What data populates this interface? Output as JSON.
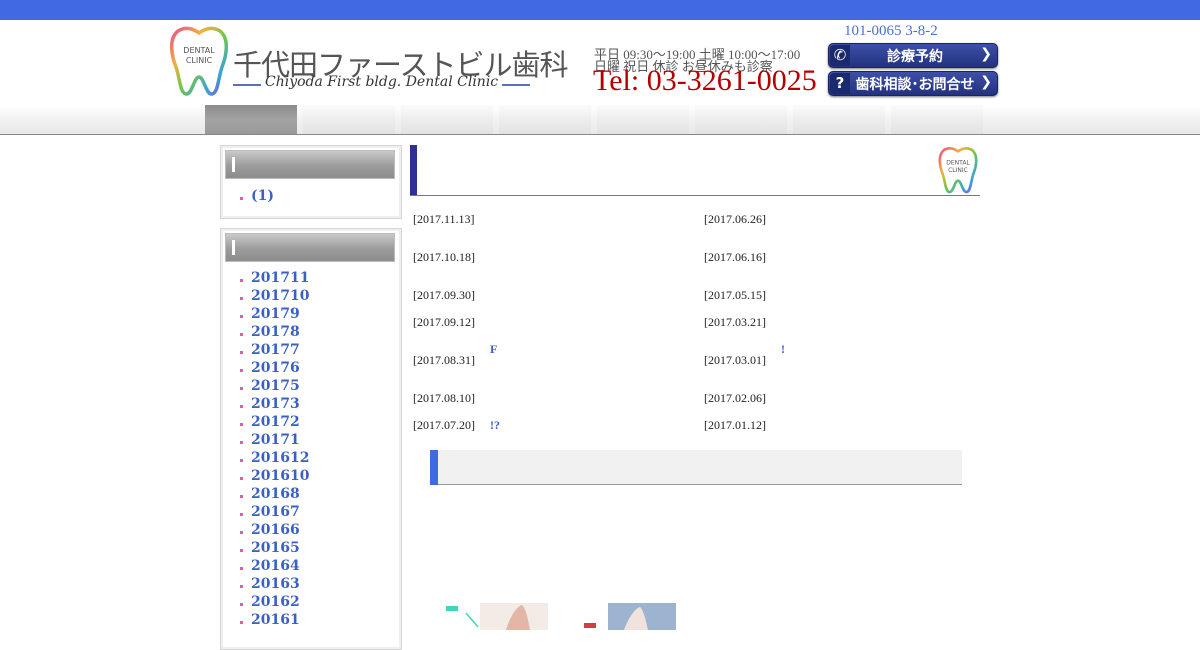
{
  "header": {
    "logo_tooth_text": [
      "DENTAL",
      "CLINIC"
    ],
    "clinic_name_jp": "千代田ファーストビル歯科",
    "clinic_name_en": "Chiyoda First bldg. Dental Clinic",
    "hours_line1": "平日 09:30〜19:00 土曜 10:00〜17:00",
    "hours_line2": "日曜 祝日 休診 お昼休みも診察",
    "tel": "Tel: 03-3261-0025",
    "postal": "101-0065 3-8-2",
    "buttons": [
      {
        "label": "診療予約",
        "icon": "phone-icon"
      },
      {
        "label": "歯科相談･お問合せ",
        "icon": "question-icon"
      }
    ]
  },
  "nav": {
    "items": [
      "",
      "",
      "",
      "",
      "",
      "",
      "",
      ""
    ],
    "active_index": 0
  },
  "sidebar": {
    "box1": {
      "heading": "",
      "items": [
        "(1)"
      ]
    },
    "box2": {
      "heading": "",
      "items": [
        "201711",
        "201710",
        "20179",
        "20178",
        "20177",
        "20176",
        "20175",
        "20173",
        "20172",
        "20171",
        "201612",
        "201610",
        "20168",
        "20167",
        "20166",
        "20165",
        "20164",
        "20163",
        "20162",
        "20161"
      ]
    }
  },
  "main": {
    "heading": "",
    "news_left": [
      {
        "date": "[2017.11.13]",
        "mark": ""
      },
      {
        "date": "[2017.10.18]",
        "mark": ""
      },
      {
        "date": "[2017.09.30]",
        "mark": ""
      },
      {
        "date": "[2017.09.12]",
        "mark": ""
      },
      {
        "date": "[2017.08.31]",
        "mark": "F"
      },
      {
        "date": "[2017.08.10]",
        "mark": ""
      },
      {
        "date": "[2017.07.20]",
        "mark": "!?"
      }
    ],
    "news_right": [
      {
        "date": "[2017.06.26]",
        "mark": ""
      },
      {
        "date": "[2017.06.16]",
        "mark": ""
      },
      {
        "date": "[2017.05.15]",
        "mark": ""
      },
      {
        "date": "[2017.03.21]",
        "mark": ""
      },
      {
        "date": "[2017.03.01]",
        "mark": "!"
      },
      {
        "date": "[2017.02.06]",
        "mark": ""
      },
      {
        "date": "[2017.01.12]",
        "mark": ""
      }
    ],
    "subheading": ""
  },
  "colors": {
    "topbar": "#4169e1",
    "tel": "#b40000",
    "link": "#3a60c4",
    "heading_bar": "#2e3190",
    "button": "#2c3c8f",
    "bullet": "#e05fa4"
  }
}
